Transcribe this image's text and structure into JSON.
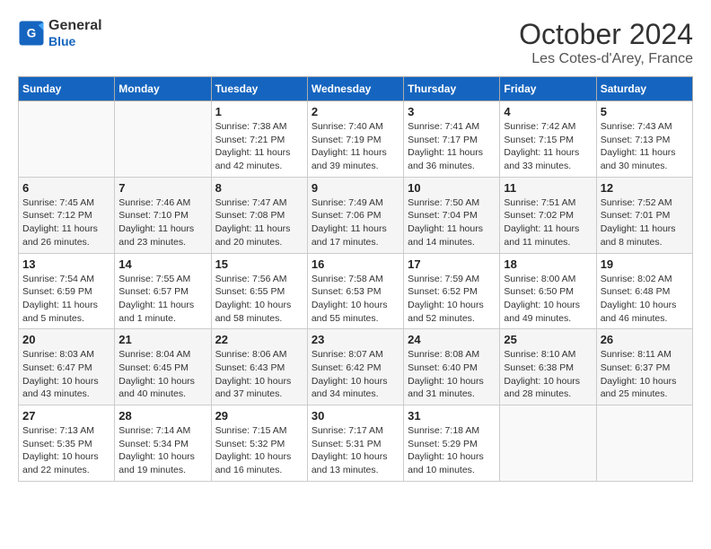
{
  "header": {
    "logo_line1": "General",
    "logo_line2": "Blue",
    "month": "October 2024",
    "location": "Les Cotes-d'Arey, France"
  },
  "weekdays": [
    "Sunday",
    "Monday",
    "Tuesday",
    "Wednesday",
    "Thursday",
    "Friday",
    "Saturday"
  ],
  "weeks": [
    [
      {
        "day": "",
        "info": ""
      },
      {
        "day": "",
        "info": ""
      },
      {
        "day": "1",
        "info": "Sunrise: 7:38 AM\nSunset: 7:21 PM\nDaylight: 11 hours and 42 minutes."
      },
      {
        "day": "2",
        "info": "Sunrise: 7:40 AM\nSunset: 7:19 PM\nDaylight: 11 hours and 39 minutes."
      },
      {
        "day": "3",
        "info": "Sunrise: 7:41 AM\nSunset: 7:17 PM\nDaylight: 11 hours and 36 minutes."
      },
      {
        "day": "4",
        "info": "Sunrise: 7:42 AM\nSunset: 7:15 PM\nDaylight: 11 hours and 33 minutes."
      },
      {
        "day": "5",
        "info": "Sunrise: 7:43 AM\nSunset: 7:13 PM\nDaylight: 11 hours and 30 minutes."
      }
    ],
    [
      {
        "day": "6",
        "info": "Sunrise: 7:45 AM\nSunset: 7:12 PM\nDaylight: 11 hours and 26 minutes."
      },
      {
        "day": "7",
        "info": "Sunrise: 7:46 AM\nSunset: 7:10 PM\nDaylight: 11 hours and 23 minutes."
      },
      {
        "day": "8",
        "info": "Sunrise: 7:47 AM\nSunset: 7:08 PM\nDaylight: 11 hours and 20 minutes."
      },
      {
        "day": "9",
        "info": "Sunrise: 7:49 AM\nSunset: 7:06 PM\nDaylight: 11 hours and 17 minutes."
      },
      {
        "day": "10",
        "info": "Sunrise: 7:50 AM\nSunset: 7:04 PM\nDaylight: 11 hours and 14 minutes."
      },
      {
        "day": "11",
        "info": "Sunrise: 7:51 AM\nSunset: 7:02 PM\nDaylight: 11 hours and 11 minutes."
      },
      {
        "day": "12",
        "info": "Sunrise: 7:52 AM\nSunset: 7:01 PM\nDaylight: 11 hours and 8 minutes."
      }
    ],
    [
      {
        "day": "13",
        "info": "Sunrise: 7:54 AM\nSunset: 6:59 PM\nDaylight: 11 hours and 5 minutes."
      },
      {
        "day": "14",
        "info": "Sunrise: 7:55 AM\nSunset: 6:57 PM\nDaylight: 11 hours and 1 minute."
      },
      {
        "day": "15",
        "info": "Sunrise: 7:56 AM\nSunset: 6:55 PM\nDaylight: 10 hours and 58 minutes."
      },
      {
        "day": "16",
        "info": "Sunrise: 7:58 AM\nSunset: 6:53 PM\nDaylight: 10 hours and 55 minutes."
      },
      {
        "day": "17",
        "info": "Sunrise: 7:59 AM\nSunset: 6:52 PM\nDaylight: 10 hours and 52 minutes."
      },
      {
        "day": "18",
        "info": "Sunrise: 8:00 AM\nSunset: 6:50 PM\nDaylight: 10 hours and 49 minutes."
      },
      {
        "day": "19",
        "info": "Sunrise: 8:02 AM\nSunset: 6:48 PM\nDaylight: 10 hours and 46 minutes."
      }
    ],
    [
      {
        "day": "20",
        "info": "Sunrise: 8:03 AM\nSunset: 6:47 PM\nDaylight: 10 hours and 43 minutes."
      },
      {
        "day": "21",
        "info": "Sunrise: 8:04 AM\nSunset: 6:45 PM\nDaylight: 10 hours and 40 minutes."
      },
      {
        "day": "22",
        "info": "Sunrise: 8:06 AM\nSunset: 6:43 PM\nDaylight: 10 hours and 37 minutes."
      },
      {
        "day": "23",
        "info": "Sunrise: 8:07 AM\nSunset: 6:42 PM\nDaylight: 10 hours and 34 minutes."
      },
      {
        "day": "24",
        "info": "Sunrise: 8:08 AM\nSunset: 6:40 PM\nDaylight: 10 hours and 31 minutes."
      },
      {
        "day": "25",
        "info": "Sunrise: 8:10 AM\nSunset: 6:38 PM\nDaylight: 10 hours and 28 minutes."
      },
      {
        "day": "26",
        "info": "Sunrise: 8:11 AM\nSunset: 6:37 PM\nDaylight: 10 hours and 25 minutes."
      }
    ],
    [
      {
        "day": "27",
        "info": "Sunrise: 7:13 AM\nSunset: 5:35 PM\nDaylight: 10 hours and 22 minutes."
      },
      {
        "day": "28",
        "info": "Sunrise: 7:14 AM\nSunset: 5:34 PM\nDaylight: 10 hours and 19 minutes."
      },
      {
        "day": "29",
        "info": "Sunrise: 7:15 AM\nSunset: 5:32 PM\nDaylight: 10 hours and 16 minutes."
      },
      {
        "day": "30",
        "info": "Sunrise: 7:17 AM\nSunset: 5:31 PM\nDaylight: 10 hours and 13 minutes."
      },
      {
        "day": "31",
        "info": "Sunrise: 7:18 AM\nSunset: 5:29 PM\nDaylight: 10 hours and 10 minutes."
      },
      {
        "day": "",
        "info": ""
      },
      {
        "day": "",
        "info": ""
      }
    ]
  ]
}
